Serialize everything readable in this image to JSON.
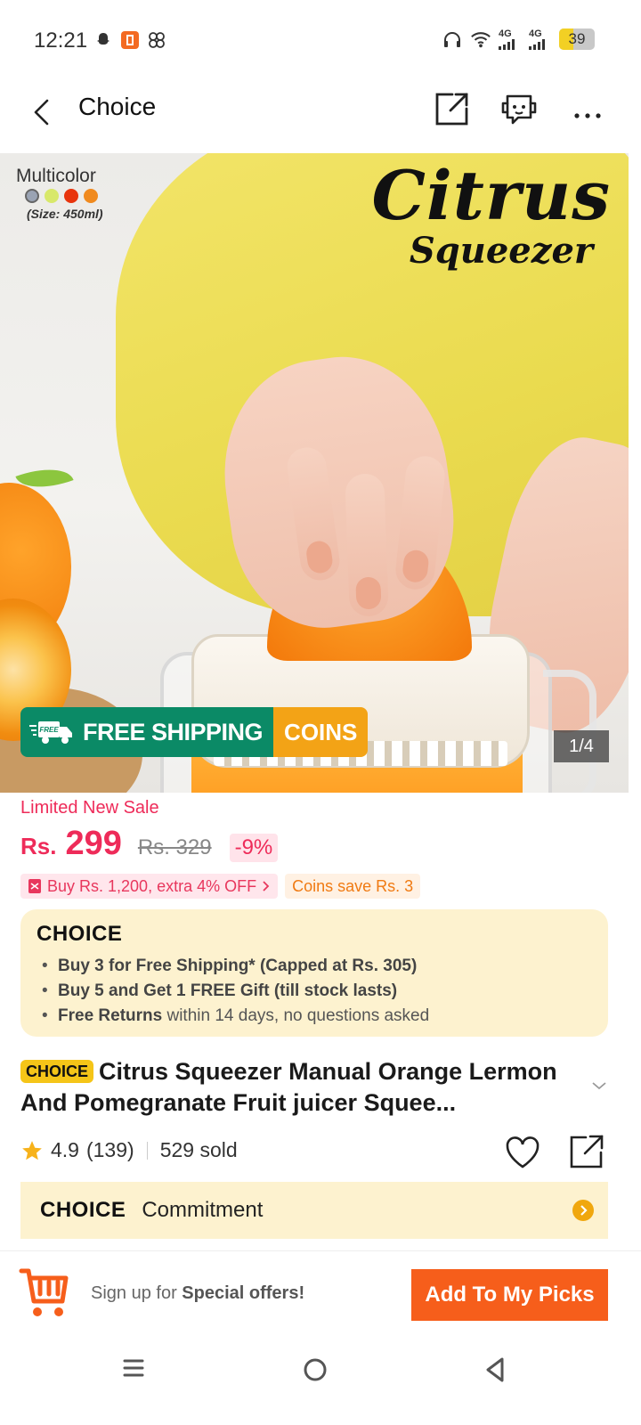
{
  "status_bar": {
    "time": "12:21",
    "network_1": "4G",
    "network_2": "4G",
    "battery_level": "39",
    "battery_percent": 39
  },
  "header": {
    "title": "Choice"
  },
  "hero": {
    "variant_title": "Multicolor",
    "swatch_colors": [
      "#9aa3b3",
      "#d8e86a",
      "#e8340c",
      "#f08a1e"
    ],
    "size_note": "(Size: 450ml)",
    "brand_title_line1": "Citrus",
    "brand_title_line2": "Squeezer",
    "shipping_badge_small": "FREE",
    "shipping_label": "FREE SHIPPING",
    "coins_label": "COINS",
    "page_counter": "1/4"
  },
  "price": {
    "sale_label": "Limited New Sale",
    "currency": "Rs.",
    "current": "299",
    "original": "Rs. 329",
    "discount": "-9%"
  },
  "promos": {
    "bundle": "Buy Rs. 1,200, extra 4% OFF",
    "coins": "Coins save Rs. 3"
  },
  "choice_box": {
    "logo": "CHOICE",
    "items": [
      {
        "bold": "Buy 3 for  Free Shipping* (Capped at Rs. 305)",
        "rest": ""
      },
      {
        "bold": "Buy 5 and Get 1 FREE Gift (till stock lasts)",
        "rest": ""
      },
      {
        "bold": "Free Returns",
        "rest": " within 14 days, no questions asked"
      }
    ]
  },
  "product": {
    "badge": "CHOICE",
    "title": "Citrus Squeezer Manual Orange Lermon And Pomegranate Fruit juicer Squee..."
  },
  "rating": {
    "score": "4.9",
    "count": "(139)",
    "sold": "529 sold"
  },
  "commitment": {
    "logo": "CHOICE",
    "label": "Commitment"
  },
  "bottom_bar": {
    "signup_prefix": "Sign up for ",
    "signup_bold": "Special offers!",
    "picks_button": "Add To My Picks"
  },
  "colors": {
    "accent_pink": "#ee2b59",
    "accent_orange": "#f65e1b",
    "choice_yellow": "#fdf2cf",
    "shipping_green": "#0b8a66",
    "coins_orange": "#f3a316"
  }
}
